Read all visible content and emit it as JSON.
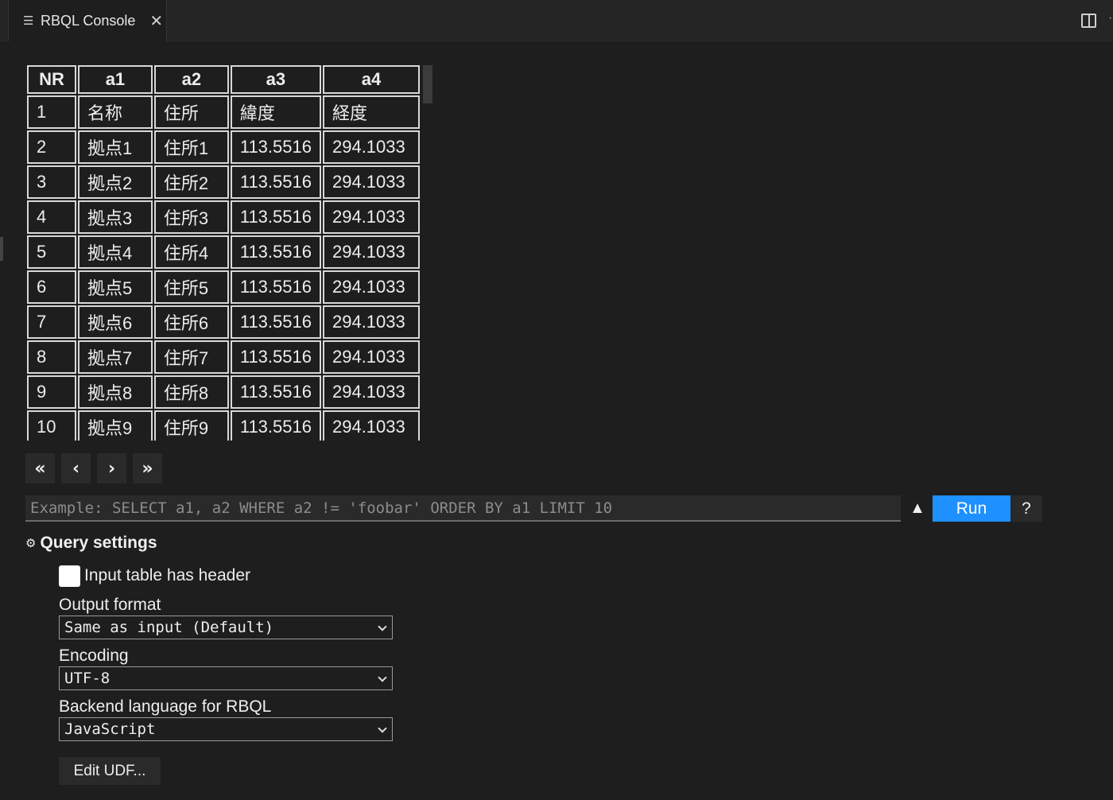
{
  "tab": {
    "title": "RBQL Console",
    "icon": "preview-icon",
    "close_icon": "close-icon"
  },
  "grid": {
    "headers": [
      "NR",
      "a1",
      "a2",
      "a3",
      "a4"
    ],
    "rows": [
      [
        "1",
        "名称",
        "住所",
        "緯度",
        "経度"
      ],
      [
        "2",
        "拠点1",
        "住所1",
        "113.5516",
        "294.1033"
      ],
      [
        "3",
        "拠点2",
        "住所2",
        "113.5516",
        "294.1033"
      ],
      [
        "4",
        "拠点3",
        "住所3",
        "113.5516",
        "294.1033"
      ],
      [
        "5",
        "拠点4",
        "住所4",
        "113.5516",
        "294.1033"
      ],
      [
        "6",
        "拠点5",
        "住所5",
        "113.5516",
        "294.1033"
      ],
      [
        "7",
        "拠点6",
        "住所6",
        "113.5516",
        "294.1033"
      ],
      [
        "8",
        "拠点7",
        "住所7",
        "113.5516",
        "294.1033"
      ],
      [
        "9",
        "拠点8",
        "住所8",
        "113.5516",
        "294.1033"
      ],
      [
        "10",
        "拠点9",
        "住所9",
        "113.5516",
        "294.1033"
      ]
    ]
  },
  "pager": {
    "first": "«",
    "prev": "‹",
    "next": "›",
    "last": "»"
  },
  "query": {
    "placeholder": "Example: SELECT a1, a2 WHERE a2 != 'foobar' ORDER BY a1 LIMIT 10",
    "history_glyph": "▲",
    "run_label": "Run",
    "help_label": "?"
  },
  "settings": {
    "title": "Query settings",
    "gear_glyph": "⚙",
    "header_checkbox_label": "Input table has header",
    "header_checked": false,
    "output_format_label": "Output format",
    "output_format_value": "Same as input (Default)",
    "encoding_label": "Encoding",
    "encoding_value": "UTF-8",
    "backend_label": "Backend language for RBQL",
    "backend_value": "JavaScript",
    "edit_udf_label": "Edit UDF..."
  }
}
